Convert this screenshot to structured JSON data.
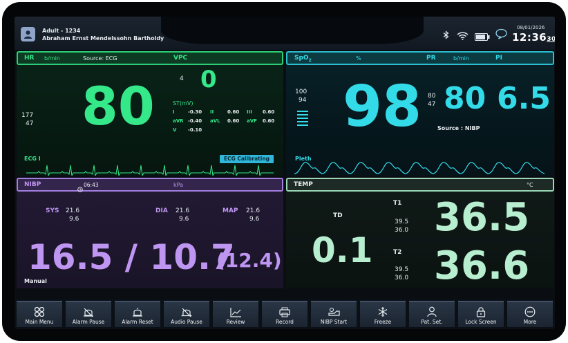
{
  "header": {
    "patient_type": "Adult - 1234",
    "patient_name": "Abraham Ernst Mendelssohn Bartholdy",
    "date": "08/01/2026",
    "time_hm": "12:36",
    "time_s": "30"
  },
  "hr": {
    "label": "HR",
    "unit": "b/min",
    "source": "Source: ECG",
    "vpc_label": "VPC",
    "value": "80",
    "alarm_high": "177",
    "alarm_low": "47",
    "vpc_small": "4",
    "vpc_value": "0",
    "st_label": "ST(mV)",
    "st": [
      {
        "lead": "I",
        "value": "-0.30"
      },
      {
        "lead": "II",
        "value": "0.60"
      },
      {
        "lead": "III",
        "value": "0.60"
      },
      {
        "lead": "aVR",
        "value": "-0.40"
      },
      {
        "lead": "aVL",
        "value": "0.60"
      },
      {
        "lead": "aVF",
        "value": "0.60"
      },
      {
        "lead": "V",
        "value": "-0.10"
      }
    ],
    "wave_label": "ECG I",
    "status": "ECG Calibrating"
  },
  "spo2": {
    "label": "SpO",
    "label_sub": "2",
    "unit": "%",
    "pr_label": "PR",
    "pr_unit": "b/min",
    "pi_label": "PI",
    "alarm_high": "100",
    "alarm_low": "94",
    "value": "98",
    "pr_high": "80",
    "pr_low": "47",
    "pr_value": "80",
    "pi_value": "6.5",
    "source": "Source : NIBP",
    "wave_label": "Pleth"
  },
  "nibp": {
    "label": "NIBP",
    "time": "06:43",
    "unit": "kPa",
    "sys_label": "SYS",
    "sys_high": "21.6",
    "sys_low": "9.6",
    "dia_label": "DIA",
    "dia_high": "21.6",
    "dia_low": "9.6",
    "map_label": "MAP",
    "map_high": "21.6",
    "map_low": "9.6",
    "value": "16.5 / 10.7",
    "map_value": "(12.4)",
    "mode": "Manual"
  },
  "temp": {
    "label": "TEMP",
    "unit": "°C",
    "td_label": "TD",
    "td_value": "0.1",
    "t1_label": "T1",
    "t1_high": "39.5",
    "t1_low": "36.0",
    "t1_value": "36.5",
    "t2_label": "T2",
    "t2_high": "39.5",
    "t2_low": "36.0",
    "t2_value": "36.6"
  },
  "footer": {
    "buttons": [
      {
        "label": "Main Menu",
        "icon": "main-menu-icon"
      },
      {
        "label": "Alarm Pause",
        "icon": "alarm-pause-icon"
      },
      {
        "label": "Alarm Reset",
        "icon": "alarm-reset-icon"
      },
      {
        "label": "Audio Pause",
        "icon": "audio-pause-icon"
      },
      {
        "label": "Review",
        "icon": "review-icon"
      },
      {
        "label": "Record",
        "icon": "record-icon"
      },
      {
        "label": "NIBP Start",
        "icon": "nibp-start-icon"
      },
      {
        "label": "Freeze",
        "icon": "freeze-icon"
      },
      {
        "label": "Pat. Set.",
        "icon": "patient-settings-icon"
      },
      {
        "label": "Lock Screen",
        "icon": "lock-icon"
      },
      {
        "label": "More",
        "icon": "more-icon"
      }
    ]
  },
  "colors": {
    "hr": "#35e88a",
    "spo2": "#33dbe9",
    "nibp": "#bf95f2",
    "temp": "#b8eed0"
  }
}
